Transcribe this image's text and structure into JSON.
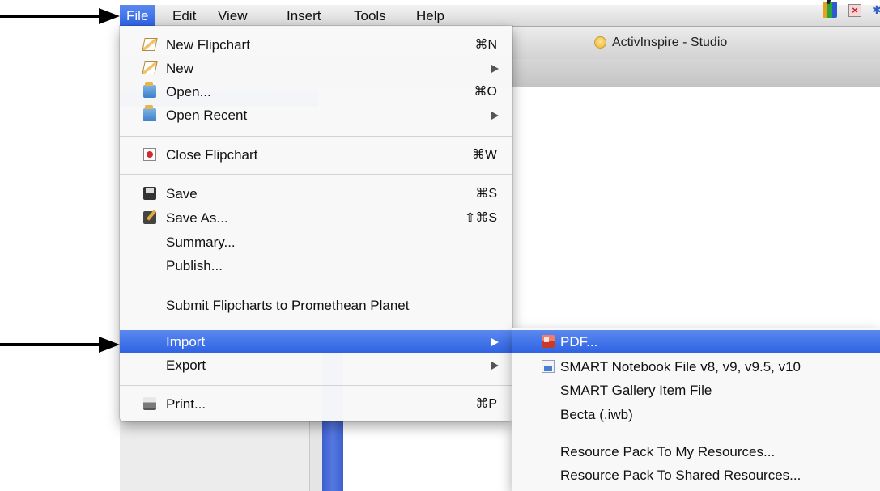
{
  "menubar": {
    "items": [
      "File",
      "Edit",
      "View",
      "Insert",
      "Tools",
      "Help"
    ],
    "active": "File"
  },
  "window": {
    "title": "ActivInspire - Studio"
  },
  "file_menu": {
    "items": [
      {
        "label": "New Flipchart",
        "shortcut": "⌘N",
        "icon": "new-flipchart-icon"
      },
      {
        "label": "New",
        "submenu": true,
        "icon": "new-icon"
      },
      {
        "label": "Open...",
        "shortcut": "⌘O",
        "icon": "open-folder-icon"
      },
      {
        "label": "Open Recent",
        "submenu": true,
        "icon": "open-recent-icon"
      },
      {
        "label": "Close Flipchart",
        "shortcut": "⌘W",
        "icon": "close-flipchart-icon"
      },
      {
        "label": "Save",
        "shortcut": "⌘S",
        "icon": "save-icon"
      },
      {
        "label": "Save As...",
        "shortcut": "⇧⌘S",
        "icon": "save-as-icon"
      },
      {
        "label": "Summary..."
      },
      {
        "label": "Publish..."
      },
      {
        "label": "Submit Flipcharts to Promethean Planet"
      },
      {
        "label": "Import",
        "submenu": true,
        "highlighted": true
      },
      {
        "label": "Export",
        "submenu": true
      },
      {
        "label": "Print...",
        "shortcut": "⌘P",
        "icon": "printer-icon"
      }
    ]
  },
  "import_menu": {
    "items": [
      {
        "label": "PDF...",
        "highlighted": true,
        "icon": "pdf-icon"
      },
      {
        "label": "SMART Notebook File v8, v9, v9.5, v10",
        "icon": "smart-notebook-icon"
      },
      {
        "label": "SMART Gallery Item File"
      },
      {
        "label": "Becta (.iwb)"
      },
      {
        "label": "Resource Pack To My Resources..."
      },
      {
        "label": "Resource Pack To Shared Resources..."
      }
    ]
  },
  "colors": {
    "highlight": "#2f63e5",
    "menu_bg": "#f8f8f8",
    "arrow": "#000000"
  }
}
